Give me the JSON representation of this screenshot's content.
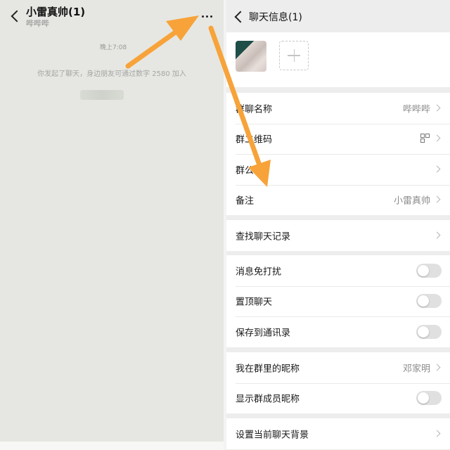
{
  "left": {
    "title": "小雷真帅(1)",
    "subtitle": "哔哔哔",
    "time": "晚上7:08",
    "system_message": "你发起了聊天，身边朋友可通过数字 2580 加入"
  },
  "right": {
    "title": "聊天信息(1)",
    "group1": [
      {
        "label": "群聊名称",
        "value": "哔哔哔"
      },
      {
        "label": "群二维码",
        "value": ""
      },
      {
        "label": "群公告",
        "value": ""
      },
      {
        "label": "备注",
        "value": "小雷真帅"
      }
    ],
    "group2": [
      {
        "label": "查找聊天记录"
      }
    ],
    "group3": [
      {
        "label": "消息免打扰",
        "toggle": false
      },
      {
        "label": "置顶聊天",
        "toggle": false
      },
      {
        "label": "保存到通讯录",
        "toggle": false
      }
    ],
    "group4": [
      {
        "label": "我在群里的昵称",
        "value": "邓家明"
      },
      {
        "label": "显示群成员昵称",
        "toggle": false
      }
    ],
    "group5": [
      {
        "label": "设置当前聊天背景"
      }
    ]
  },
  "colors": {
    "arrow": "#f7a33a",
    "toggle_off": "#e0e0e0"
  }
}
